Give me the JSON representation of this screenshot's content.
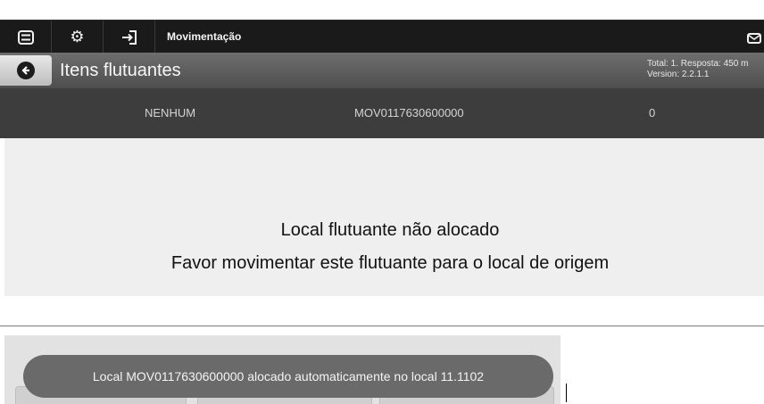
{
  "topbar": {
    "title": "Movimentação",
    "icons": [
      "menu-icon",
      "gear-icon",
      "login-icon",
      "mail-icon"
    ]
  },
  "subheader": {
    "title": "Itens flutuantes",
    "info_line1": "Total: 1. Resposta: 450 m",
    "info_line2": "Version: 2.2.1.1"
  },
  "row": {
    "col1": "NENHUM",
    "col2": "MOV0117630600000",
    "col3": "0"
  },
  "message": {
    "line1": "Local flutuante não alocado",
    "line2": "Favor movimentar este flutuante para o local de origem"
  },
  "toast": {
    "text": "Local MOV0117630600000 alocado automaticamente no local 11.1102"
  }
}
